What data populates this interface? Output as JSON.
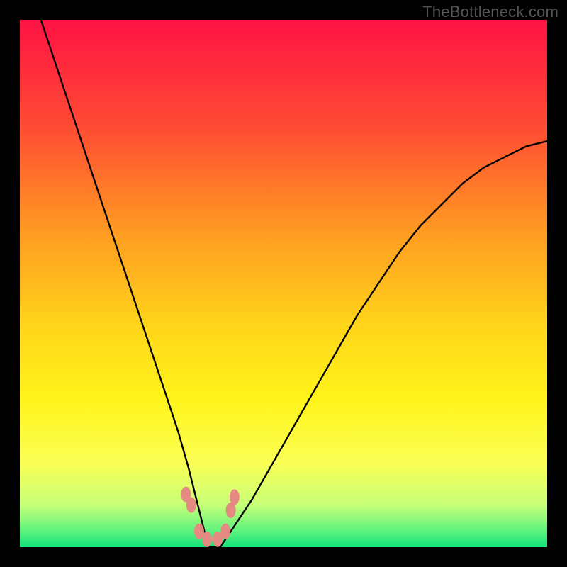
{
  "watermark": "TheBottleneck.com",
  "chart_data": {
    "type": "line",
    "title": "",
    "xlabel": "",
    "ylabel": "",
    "xlim": [
      0,
      100
    ],
    "ylim": [
      0,
      100
    ],
    "grid": false,
    "legend": false,
    "background_gradient_stops": [
      {
        "offset": 0.0,
        "color": "#ff1344"
      },
      {
        "offset": 0.2,
        "color": "#ff4a34"
      },
      {
        "offset": 0.4,
        "color": "#ff9a22"
      },
      {
        "offset": 0.58,
        "color": "#ffd51a"
      },
      {
        "offset": 0.72,
        "color": "#fff41a"
      },
      {
        "offset": 0.84,
        "color": "#fbff55"
      },
      {
        "offset": 0.92,
        "color": "#c7ff78"
      },
      {
        "offset": 0.97,
        "color": "#5cf37f"
      },
      {
        "offset": 1.0,
        "color": "#11e27a"
      }
    ],
    "series": [
      {
        "name": "bottleneck-curve",
        "color": "#000000",
        "x": [
          4,
          6,
          8,
          10,
          12,
          14,
          16,
          18,
          20,
          22,
          24,
          26,
          28,
          30,
          32,
          34,
          35,
          36,
          37,
          38,
          40,
          44,
          48,
          52,
          56,
          60,
          64,
          68,
          72,
          76,
          80,
          84,
          88,
          92,
          96,
          100
        ],
        "y": [
          100,
          94,
          88,
          82,
          76,
          70,
          64,
          58,
          52,
          46,
          40,
          34,
          28,
          22,
          15,
          7,
          3,
          0,
          0,
          0,
          3,
          9,
          16,
          23,
          30,
          37,
          44,
          50,
          56,
          61,
          65,
          69,
          72,
          74,
          76,
          77
        ]
      }
    ],
    "markers": {
      "name": "highlight-dots",
      "color": "#e58a82",
      "x": [
        31.5,
        32.5,
        34.0,
        35.5,
        37.5,
        39.0,
        40.0,
        40.7
      ],
      "y": [
        10.0,
        8.0,
        3.0,
        1.5,
        1.5,
        3.0,
        7.0,
        9.5
      ]
    }
  }
}
